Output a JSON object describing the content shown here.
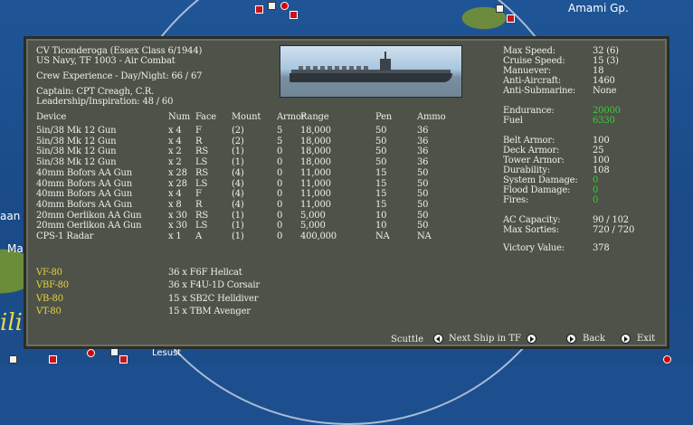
{
  "map": {
    "label_top_right": "Amami Gp.",
    "label_left_1": "aan",
    "label_left_2": "Ma",
    "label_bottom_left": "ili",
    "label_bottom": "Lesust"
  },
  "ship": {
    "name": "CV Ticonderoga (Essex Class 6/1944)",
    "navy": "US Navy, TF 1003 - Air Combat",
    "crew_experience": "Crew Experience - Day/Night: 66 / 67",
    "captain": "Captain: CPT Creagh, C.R.",
    "leadership": "Leadership/Inspiration: 48 / 60"
  },
  "table": {
    "headers": [
      "Device",
      "Num",
      "Face",
      "Mount",
      "Armor",
      "Range",
      "Pen",
      "Ammo"
    ],
    "rows": [
      [
        "5in/38 Mk 12 Gun",
        "x 4",
        "F",
        "(2)",
        "5",
        "18,000",
        "50",
        "36"
      ],
      [
        "5in/38 Mk 12 Gun",
        "x 4",
        "R",
        "(2)",
        "5",
        "18,000",
        "50",
        "36"
      ],
      [
        "5in/38 Mk 12 Gun",
        "x 2",
        "RS",
        "(1)",
        "0",
        "18,000",
        "50",
        "36"
      ],
      [
        "5in/38 Mk 12 Gun",
        "x 2",
        "LS",
        "(1)",
        "0",
        "18,000",
        "50",
        "36"
      ],
      [
        "40mm Bofors AA Gun",
        "x 28",
        "RS",
        "(4)",
        "0",
        "11,000",
        "15",
        "50"
      ],
      [
        "40mm Bofors AA Gun",
        "x 28",
        "LS",
        "(4)",
        "0",
        "11,000",
        "15",
        "50"
      ],
      [
        "40mm Bofors AA Gun",
        "x 4",
        "F",
        "(4)",
        "0",
        "11,000",
        "15",
        "50"
      ],
      [
        "40mm Bofors AA Gun",
        "x 8",
        "R",
        "(4)",
        "0",
        "11,000",
        "15",
        "50"
      ],
      [
        "20mm Oerlikon AA Gun",
        "x 30",
        "RS",
        "(1)",
        "0",
        "5,000",
        "10",
        "50"
      ],
      [
        "20mm Oerlikon AA Gun",
        "x 30",
        "LS",
        "(1)",
        "0",
        "5,000",
        "10",
        "50"
      ],
      [
        "CPS-1 Radar",
        "x 1",
        "A",
        "(1)",
        "0",
        "400,000",
        "NA",
        "NA"
      ]
    ]
  },
  "squadrons": [
    {
      "name": "VF-80",
      "aircraft": "36 x F6F Hellcat"
    },
    {
      "name": "VBF-80",
      "aircraft": "36 x F4U-1D Corsair"
    },
    {
      "name": "VB-80",
      "aircraft": "15 x SB2C Helldiver"
    },
    {
      "name": "VT-80",
      "aircraft": "15 x TBM Avenger"
    }
  ],
  "stats": {
    "max_speed": {
      "label": "Max Speed:",
      "value": "32 (6)"
    },
    "cruise_speed": {
      "label": "Cruise Speed:",
      "value": "15 (3)"
    },
    "maneuver": {
      "label": "Manuever:",
      "value": "18"
    },
    "anti_aircraft": {
      "label": "Anti-Aircraft:",
      "value": "1460"
    },
    "anti_submarine": {
      "label": "Anti-Submarine:",
      "value": "None"
    },
    "endurance": {
      "label": "Endurance:",
      "value": "20000"
    },
    "fuel": {
      "label": "Fuel",
      "value": "6330"
    },
    "belt_armor": {
      "label": "Belt Armor:",
      "value": "100"
    },
    "deck_armor": {
      "label": "Deck Armor:",
      "value": "25"
    },
    "tower_armor": {
      "label": "Tower Armor:",
      "value": "100"
    },
    "durability": {
      "label": "Durability:",
      "value": "108"
    },
    "system_damage": {
      "label": "System Damage:",
      "value": "0"
    },
    "flood_damage": {
      "label": "Flood Damage:",
      "value": "0"
    },
    "fires": {
      "label": "Fires:",
      "value": "0"
    },
    "ac_capacity": {
      "label": "AC Capacity:",
      "value": "90 / 102"
    },
    "max_sorties": {
      "label": "Max Sorties:",
      "value": "720 / 720"
    },
    "victory_value": {
      "label": "Victory Value:",
      "value": "378"
    }
  },
  "buttons": {
    "scuttle": "Scuttle",
    "next_ship": "Next Ship in TF",
    "back": "Back",
    "exit": "Exit"
  }
}
